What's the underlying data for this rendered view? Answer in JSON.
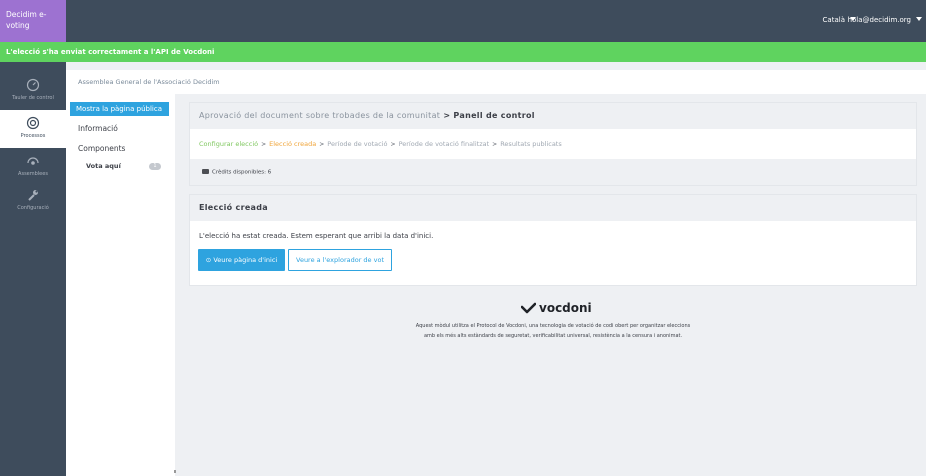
{
  "topbar": {
    "brand": "Decidim e-voting",
    "language": "Català",
    "user_email": "hola@decidim.org"
  },
  "callout": {
    "message": "L'elecció s'ha enviat correctament a l'API de Vocdoni"
  },
  "main_menu": {
    "items": [
      {
        "label": "Tauler de control",
        "icon": "dashboard-icon",
        "active": false
      },
      {
        "label": "Processos",
        "icon": "processes-icon",
        "active": true
      },
      {
        "label": "Assemblees",
        "icon": "assemblies-icon",
        "active": false
      },
      {
        "label": "Configuració",
        "icon": "wrench-icon",
        "active": false
      }
    ]
  },
  "breadcrumb": {
    "text": "Assemblea General de l'Associació Decidim"
  },
  "secondary_menu": {
    "public_button": "Mostra la pàgina pública",
    "info": "Informació",
    "components": "Components",
    "vote_here": "Vota aquí",
    "vote_badge": "1"
  },
  "control_panel": {
    "title_muted": "Aprovació del document sobre trobades de la comunitat",
    "title_sep": ">",
    "title_bold": "Panell de control",
    "steps": [
      {
        "label": "Configurar elecció",
        "state": "done"
      },
      {
        "label": "Elecció creada",
        "state": "current"
      },
      {
        "label": "Període de votació",
        "state": "pending"
      },
      {
        "label": "Període de votació finalitzat",
        "state": "pending"
      },
      {
        "label": "Resultats publicats",
        "state": "pending"
      }
    ],
    "step_sep": ">",
    "credits": "Crèdits disponibles: 6"
  },
  "election_card": {
    "title": "Elecció creada",
    "message": "L'elecció ha estat creada. Estem esperant que arribi la data d'inici.",
    "home_button": "Veure pàgina d'inici",
    "explorer_button": "Veure a l'explorador de vot"
  },
  "vocdoni": {
    "logo_text": "vocdoni",
    "desc_line1": "Aquest mòdul utilitza el Protocol de Vocdoni, una tecnologia de votació de codi obert per organitzar eleccions",
    "desc_line2": "amb els més alts estàndards de seguretat, verificabilitat universal, resistència a la censura i anonimat."
  },
  "colors": {
    "topbar": "#3e4c5c",
    "brand": "#9d72d1",
    "success": "#5fd35f",
    "primary": "#2ea3df",
    "step_done": "#7fc75f",
    "step_current": "#f0a53a"
  }
}
